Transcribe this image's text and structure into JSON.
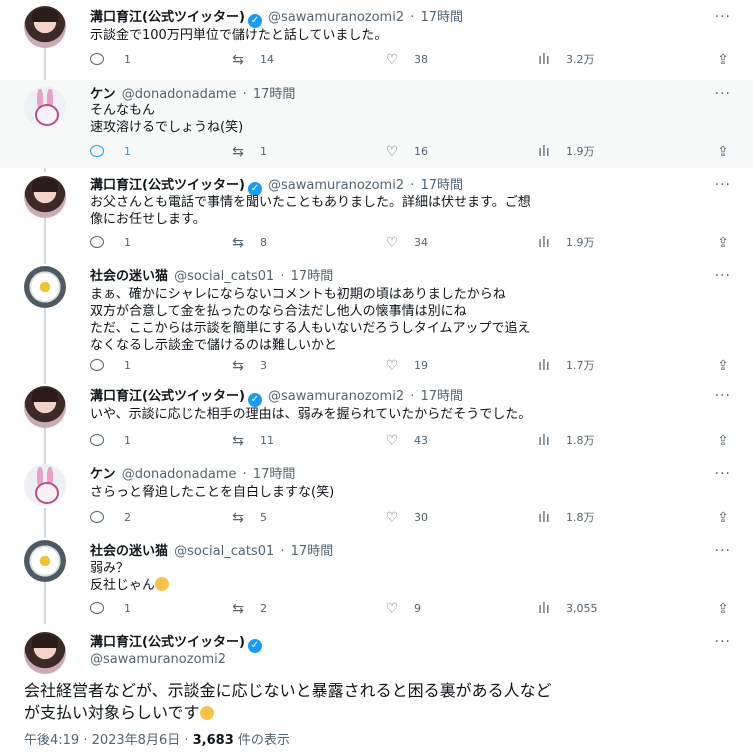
{
  "tweets": [
    {
      "name": "溝口育江(公式ツイッター)",
      "handle": "@sawamuranozomi2",
      "time": "17時間",
      "lines": [
        "示談金で100万円単位で儲けたと話していました。"
      ],
      "replies": "1",
      "retweets": "14",
      "likes": "38",
      "views": "3.2万"
    },
    {
      "name": "ケン",
      "handle": "@donadonadame",
      "time": "17時間",
      "lines": [
        "そんなもん",
        "速攻溶けるでしょうね(笑)"
      ],
      "replies": "1",
      "retweets": "1",
      "likes": "16",
      "views": "1.9万"
    },
    {
      "name": "溝口育江(公式ツイッター)",
      "handle": "@sawamuranozomi2",
      "time": "17時間",
      "lines": [
        "お父さんとも電話で事情を聞いたこともありました。詳細は伏せます。ご想",
        "像にお任せします。"
      ],
      "replies": "1",
      "retweets": "8",
      "likes": "34",
      "views": "1.9万"
    },
    {
      "name": "社会の迷い猫",
      "handle": "@social_cats01",
      "time": "17時間",
      "lines": [
        "まぁ、確かにシャレにならないコメントも初期の頃はありましたからね",
        "双方が合意して金を払ったのなら合法だし他人の懐事情は別にね",
        "ただ、ここからは示談を簡単にする人もいないだろうしタイムアップで追え",
        "なくなるし示談金で儲けるのは難しいかと"
      ],
      "replies": "1",
      "retweets": "3",
      "likes": "19",
      "views": "1.7万"
    },
    {
      "name": "溝口育江(公式ツイッター)",
      "handle": "@sawamuranozomi2",
      "time": "17時間",
      "lines": [
        "いや、示談に応じた相手の理由は、弱みを握られていたからだそうでした。"
      ],
      "replies": "1",
      "retweets": "11",
      "likes": "43",
      "views": "1.8万"
    },
    {
      "name": "ケン",
      "handle": "@donadonadame",
      "time": "17時間",
      "lines": [
        "さらっと脅迫したことを自白しますな(笑)"
      ],
      "replies": "2",
      "retweets": "5",
      "likes": "30",
      "views": "1.8万"
    },
    {
      "name": "社会の迷い猫",
      "handle": "@social_cats01",
      "time": "17時間",
      "lines": [
        "弱み？",
        "反社じゃん"
      ],
      "replies": "1",
      "retweets": "2",
      "likes": "9",
      "views": "3,055"
    }
  ],
  "main": {
    "name": "溝口育江(公式ツイッター)",
    "handle": "@sawamuranozomi2",
    "lines": [
      "会社経営者などが、示談金に応じないと暴露されると困る裏がある人など",
      "が支払い対象らしいです"
    ],
    "timestamp": "午後4:19 · 2023年8月6日 · ",
    "views_count": "3,683",
    "views_label": " 件の表示"
  },
  "ui": {
    "sep": " · ",
    "more": "···",
    "verified": "✓",
    "icons": {
      "reply": "reply-icon",
      "retweet": "retweet-icon",
      "like": "heart-icon",
      "views": "analytics-icon",
      "share": "share-icon"
    },
    "glyphs": {
      "retweet": "⇆",
      "like": "♡",
      "views": "ılı",
      "share": "⇪"
    },
    "colors": {
      "accent": "#1d9bf0",
      "muted": "#536471",
      "line": "#cfd9de"
    }
  }
}
